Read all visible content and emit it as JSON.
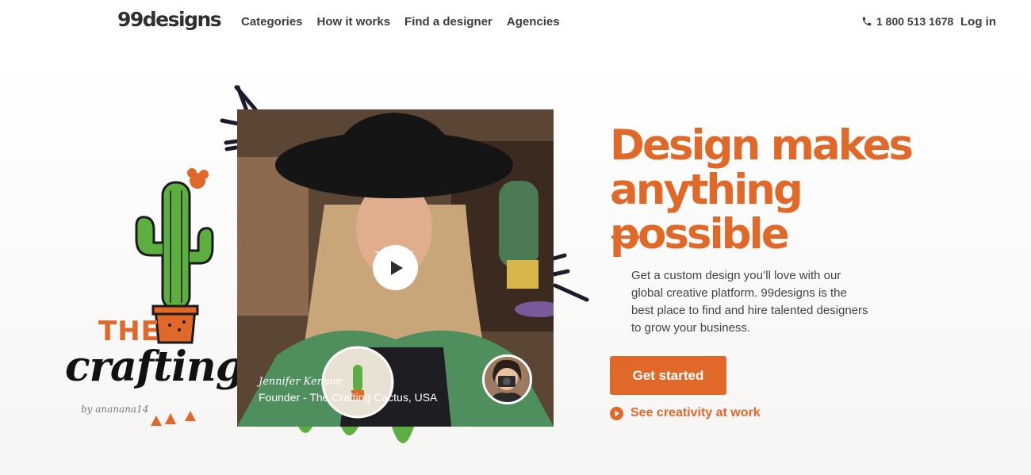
{
  "header": {
    "logo": "99designs",
    "nav": [
      "Categories",
      "How it works",
      "Find a designer",
      "Agencies"
    ],
    "phone": "1 800 513 1678",
    "login": "Log in"
  },
  "showcase": {
    "logo_word_top": "THE",
    "logo_word_script": "crafting cac",
    "byline": "by ananana14",
    "video_person_name": "Jennifer Kenyon",
    "video_person_role": "Founder - The Crafting Cactus, USA"
  },
  "hero": {
    "headline": "Design makes anything possible",
    "description": "Get a custom design you’ll love with our global creative platform. 99designs is the best place to find and hire talented designers to grow your business.",
    "cta_label": "Get started",
    "secondary_link": "See creativity at work"
  },
  "colors": {
    "accent": "#e0692a",
    "text_dark": "#3d3d3d"
  }
}
